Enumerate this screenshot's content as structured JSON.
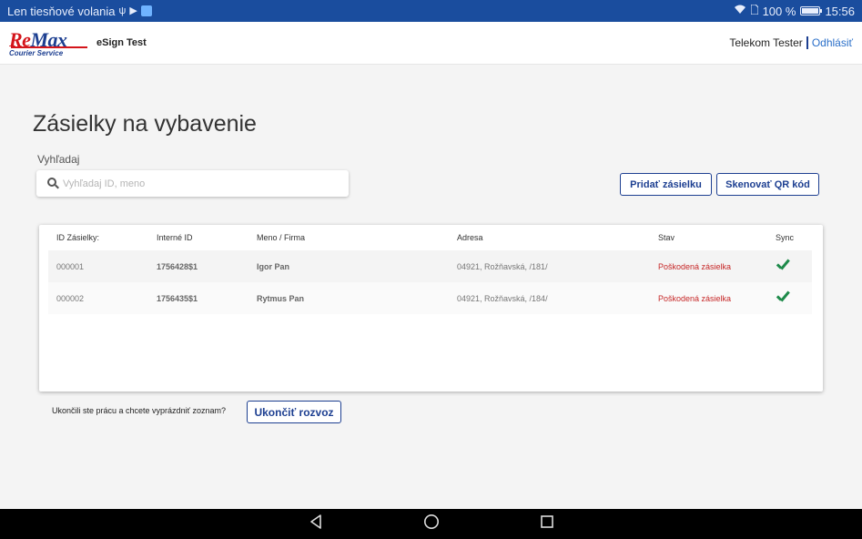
{
  "statusbar": {
    "carrier": "Len tiesňové volania",
    "battery": "100 %",
    "battery_level": 1.0,
    "time": "15:56"
  },
  "header": {
    "logo_brand_re": "Re",
    "logo_brand_max": "Max",
    "logo_sub": "Courier Service",
    "app_title": "eSign Test",
    "user_name": "Telekom Tester",
    "logout": "Odhlásiť"
  },
  "main": {
    "title": "Zásielky na vybavenie",
    "search_label": "Vyhľadaj",
    "search_placeholder": "Vyhľadaj ID, meno",
    "add_button": "Pridať zásielku",
    "scan_button": "Skenovať QR kód"
  },
  "table": {
    "columns": [
      "ID Zásielky:",
      "Interné ID",
      "Meno / Firma",
      "Adresa",
      "Stav",
      "Sync"
    ],
    "rows": [
      {
        "id": "000001",
        "internal_id": "1756428$1",
        "name": "Igor Pan",
        "address": "04921, Rožňavská, /181/",
        "status": "Poškodená zásielka",
        "sync": "check-icon"
      },
      {
        "id": "000002",
        "internal_id": "1756435$1",
        "name": "Rytmus Pan",
        "address": "04921, Rožňavská, /184/",
        "status": "Poškodená zásielka",
        "sync": "check-icon"
      }
    ]
  },
  "footer": {
    "question": "Ukončili ste prácu a chcete vyprázdniť zoznam?",
    "finish_button": "Ukončiť rozvoz"
  },
  "colors": {
    "brand_blue": "#1d3f91",
    "brand_red": "#d4151b",
    "status_damaged": "#c62828",
    "sync_ok": "#1e8a4a"
  }
}
